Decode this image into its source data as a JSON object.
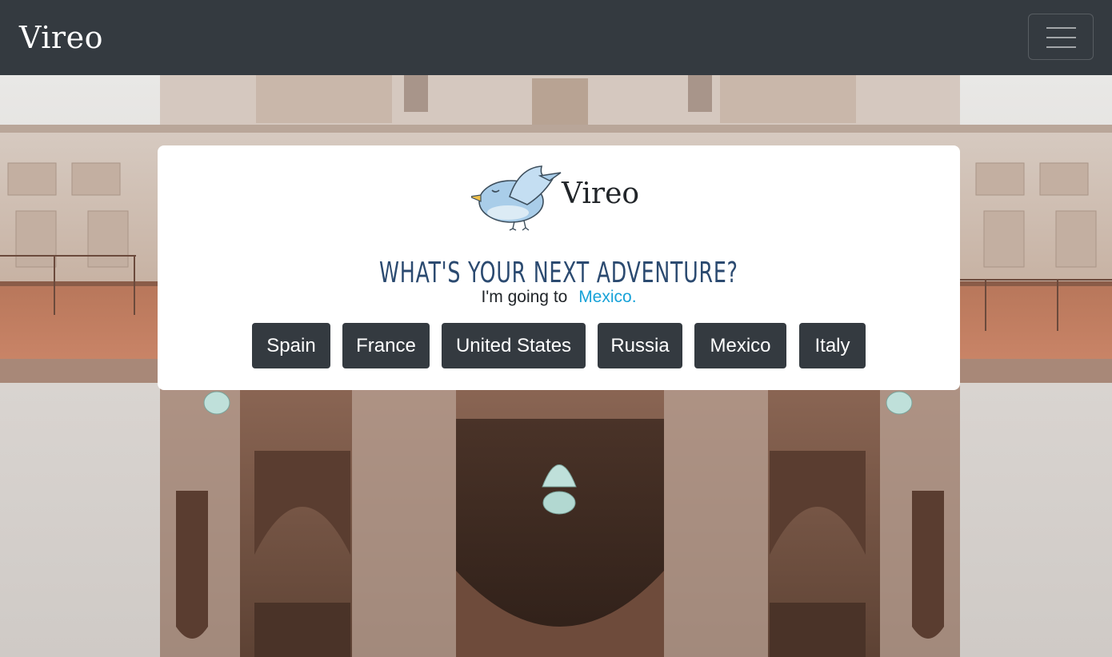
{
  "navbar": {
    "brand": "Vireo",
    "toggle_icon": "hamburger-menu-icon",
    "background": "#343a40"
  },
  "card": {
    "logo_icon": "bluebird-logo-icon",
    "logo_text": "Vireo",
    "headline": "WHAT'S YOUR NEXT ADVENTURE?",
    "going_prefix": "I'm going to",
    "destination": "Mexico.",
    "destination_color": "#17a2d8",
    "buttons": [
      {
        "label": "Spain"
      },
      {
        "label": "France"
      },
      {
        "label": "United States"
      },
      {
        "label": "Russia"
      },
      {
        "label": "Mexico"
      },
      {
        "label": "Italy"
      }
    ]
  },
  "colors": {
    "button_bg": "#343a40",
    "headline": "#2b4a70"
  }
}
